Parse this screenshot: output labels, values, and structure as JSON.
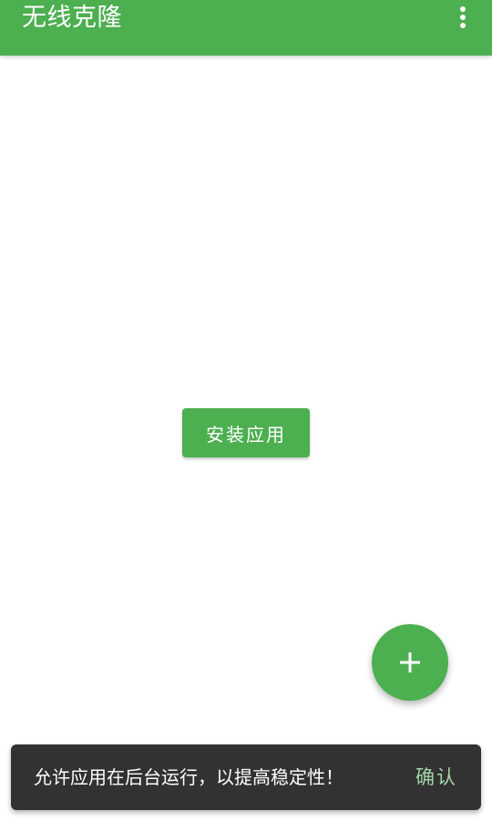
{
  "app_bar": {
    "title": "无线克隆",
    "overflow_icon": "more-vert-icon",
    "color": "#4caf50"
  },
  "main": {
    "install_button_label": "安装应用"
  },
  "fab": {
    "icon": "plus-icon",
    "symbol": "+"
  },
  "snackbar": {
    "message": "允许应用在后台运行，以提高稳定性！",
    "action_label": "确认",
    "background": "#323232",
    "action_color": "#a5d6a7"
  }
}
